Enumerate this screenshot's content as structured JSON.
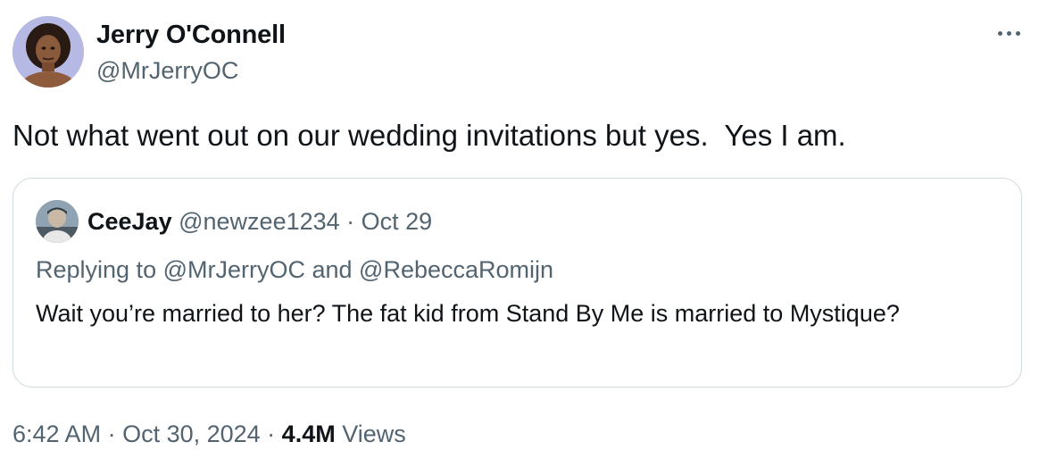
{
  "author": {
    "name": "Jerry O'Connell",
    "handle": "@MrJerryOC",
    "avatar_icon": "user-avatar"
  },
  "more_icon": "ellipsis-icon",
  "tweet": {
    "text": "Not what went out on our wedding invitations but yes.  Yes I am."
  },
  "quote": {
    "name": "CeeJay",
    "handle": "@newzee1234",
    "separator": " · ",
    "date": "Oct 29",
    "reply_prefix": "Replying to ",
    "reply_mention_1": "@MrJerryOC",
    "reply_and": " and ",
    "reply_mention_2": "@RebeccaRomijn",
    "text": "Wait you’re married to her? The fat kid from Stand By Me is married to Mystique?"
  },
  "footer": {
    "time": "6:42 AM",
    "sep1": " · ",
    "date": "Oct 30, 2024",
    "sep2": " · ",
    "views_count": "4.4M",
    "views_label": " Views"
  },
  "colors": {
    "text_primary": "#0f1419",
    "text_secondary": "#536471",
    "border": "#cfd9de"
  }
}
